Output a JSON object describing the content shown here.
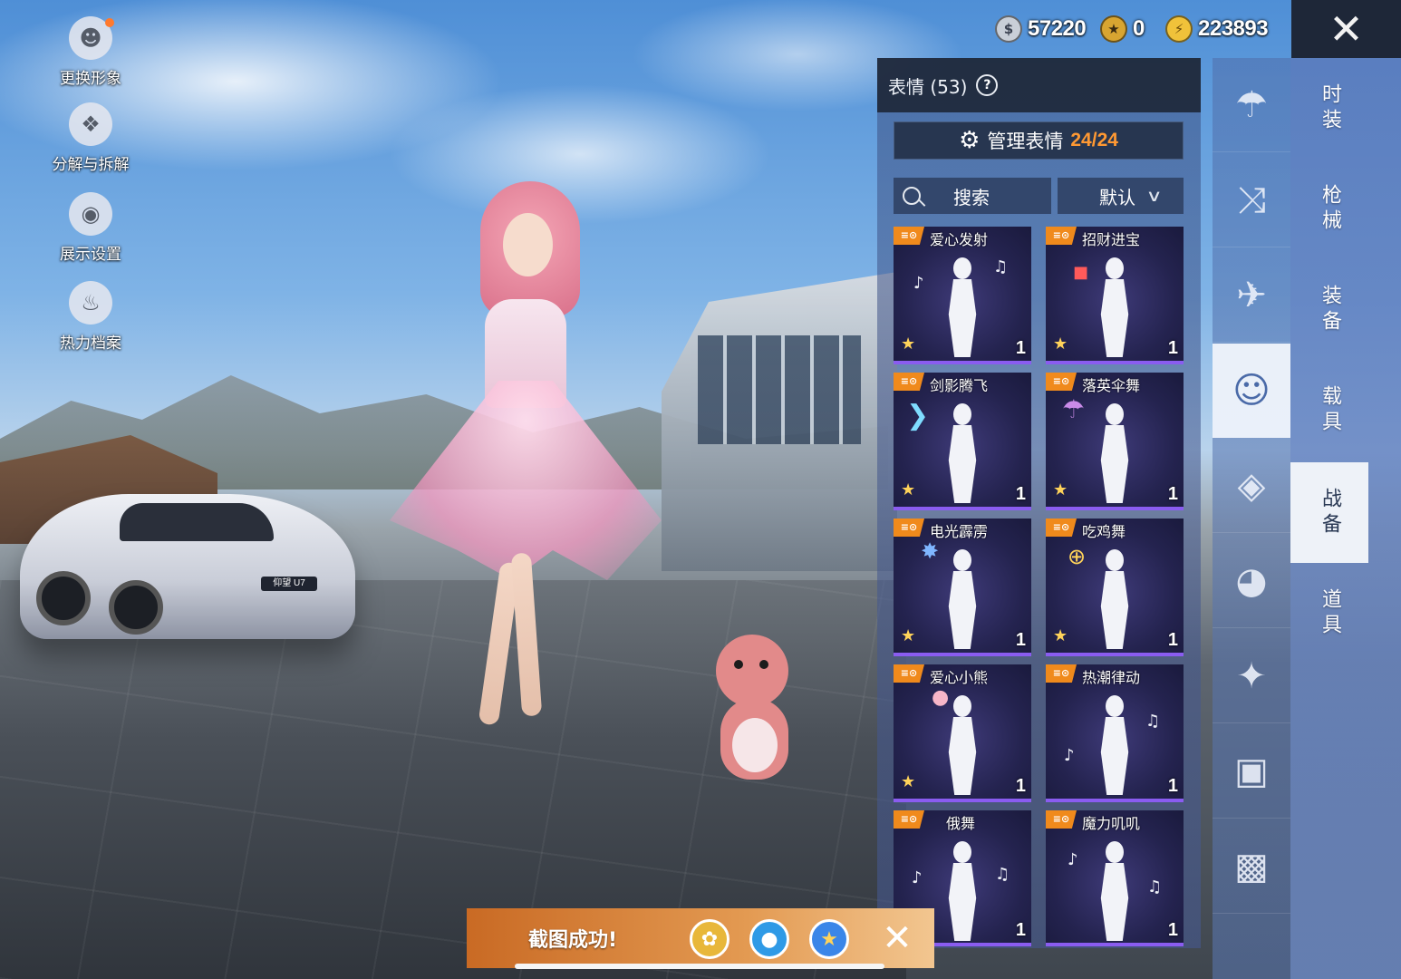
{
  "left_menu": {
    "items": [
      {
        "label": "更换形象",
        "icon": "avatar-icon"
      },
      {
        "label": "分解与拆解",
        "icon": "puzzle-icon"
      },
      {
        "label": "展示设置",
        "icon": "eye-icon"
      },
      {
        "label": "热力档案",
        "icon": "flame-icon"
      }
    ]
  },
  "currency": [
    {
      "value": "57220",
      "icon": "silver-coin-icon",
      "color": "#c9cfd8"
    },
    {
      "value": "0",
      "icon": "gold-token-icon",
      "color": "#d8a531"
    },
    {
      "value": "223893",
      "icon": "lightning-coin-icon",
      "color": "#f0c23a"
    }
  ],
  "scene": {
    "car_plate": "仰望 U7"
  },
  "panel": {
    "title": "表情 (53)",
    "manage_label": "管理表情",
    "manage_count": "24/24",
    "search_label": "搜索",
    "sort_label": "默认",
    "accent_color": "#f08a1c"
  },
  "emotes": [
    {
      "name": "爱心发射",
      "count": "1",
      "tag": "≡⊙"
    },
    {
      "name": "招财进宝",
      "count": "1",
      "tag": "≡⊙"
    },
    {
      "name": "剑影腾飞",
      "count": "1",
      "tag": "≡⊙"
    },
    {
      "name": "落英伞舞",
      "count": "1",
      "tag": "≡⊙"
    },
    {
      "name": "电光霹雳",
      "count": "1",
      "tag": "≡⊙"
    },
    {
      "name": "吃鸡舞",
      "count": "1",
      "tag": "≡⊙"
    },
    {
      "name": "爱心小熊",
      "count": "1",
      "tag": "≡⊙"
    },
    {
      "name": "热潮律动",
      "count": "1",
      "tag": "≡⊙"
    },
    {
      "name": "俄舞",
      "count": "1",
      "tag": "≡⊙"
    },
    {
      "name": "魔力叽叽",
      "count": "1",
      "tag": "≡⊙"
    }
  ],
  "categories": [
    {
      "icon": "parachute-icon",
      "active": false
    },
    {
      "icon": "skydive-icon",
      "active": false
    },
    {
      "icon": "plane-icon",
      "active": false
    },
    {
      "icon": "emote-face-icon",
      "active": true
    },
    {
      "icon": "roast-chicken-icon",
      "active": false
    },
    {
      "icon": "helmet-icon",
      "active": false
    },
    {
      "icon": "magic-wand-icon",
      "active": false
    },
    {
      "icon": "chat-bubble-icon",
      "active": false
    },
    {
      "icon": "spray-can-icon",
      "active": false
    }
  ],
  "tabs": [
    {
      "label": "时装",
      "active": false
    },
    {
      "label": "枪械",
      "active": false
    },
    {
      "label": "装备",
      "active": false
    },
    {
      "label": "载具",
      "active": false
    },
    {
      "label": "战备",
      "active": true
    },
    {
      "label": "道具",
      "active": false
    }
  ],
  "toast": {
    "text": "截图成功!",
    "share_icons": [
      "wechat-moments-icon",
      "qq-icon",
      "qzone-icon"
    ]
  }
}
